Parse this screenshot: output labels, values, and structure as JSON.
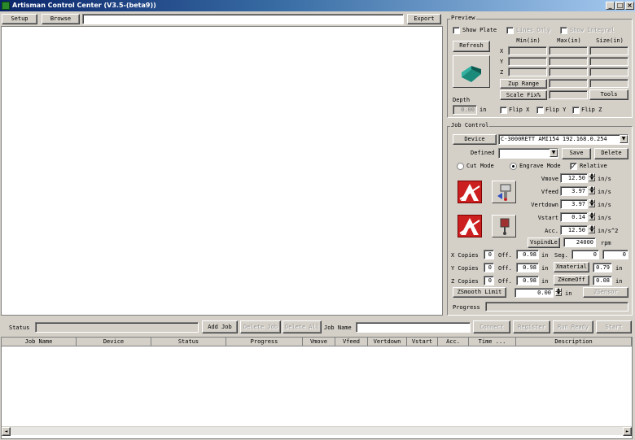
{
  "window": {
    "title": "Artisman Control Center (V3.5-(beta9))",
    "min_label": "_",
    "max_label": "□",
    "close_label": "×"
  },
  "toolbar": {
    "setup_label": "Setup",
    "browse_label": "Browse",
    "path_value": "",
    "export_label": "Export"
  },
  "preview": {
    "group_label": "Preview",
    "show_plate_label": "Show Plate",
    "lines_only_label": "Lines Only",
    "show_integral_label": "Show Integral",
    "refresh_label": "Refresh",
    "col_min": "Min(in)",
    "col_max": "Max(in)",
    "col_size": "Size(in)",
    "row_x": "X",
    "row_y": "Y",
    "row_z": "Z",
    "zup_range_label": "Zup Range",
    "scale_fixed_label": "Scale Fix%",
    "tools_label": "Tools",
    "depth_label": "Depth",
    "depth_value": "0.00",
    "depth_unit": "in",
    "flip_x_label": "Flip X",
    "flip_y_label": "Flip Y",
    "flip_z_label": "Flip Z"
  },
  "job_control": {
    "group_label": "Job Control",
    "device_label": "Device",
    "device_value": "C-3000RETT AMI154 192.168.0.254",
    "defined_label": "Defined",
    "defined_value": "",
    "save_label": "Save",
    "delete_label": "Delete",
    "cut_mode_label": "Cut Mode",
    "engrave_mode_label": "Engrave Mode",
    "relative_label": "Relative",
    "vmove_label": "Vmove",
    "vmove_value": "12.50",
    "vmove_unit": "in/s",
    "vfeed_label": "Vfeed",
    "vfeed_value": "3.97",
    "vfeed_unit": "in/s",
    "vertdown_label": "Vertdown",
    "vertdown_value": "3.97",
    "vertdown_unit": "in/s",
    "vstart_label": "Vstart",
    "vstart_value": "0.14",
    "vstart_unit": "in/s",
    "acc_label": "Acc.",
    "acc_value": "12.50",
    "acc_unit": "in/s^2",
    "vspindle_label": "VspindLe",
    "vspindle_value": "24000",
    "vspindle_unit": "rpm",
    "x_copies_label": "X Copies",
    "x_copies_value": "0",
    "x_off_label": "Off.",
    "x_off_value": "0.98",
    "x_off_unit": "in",
    "seg_label": "Seg.",
    "seg_value1": "0",
    "seg_value2": "0",
    "y_copies_label": "Y Copies",
    "y_copies_value": "0",
    "y_off_label": "Off.",
    "y_off_value": "0.98",
    "y_off_unit": "in",
    "xmaterial_label": "Xmaterial",
    "xmaterial_value": "0.79",
    "xmaterial_unit": "in",
    "z_copies_label": "Z Copies",
    "z_copies_value": "0",
    "z_off_label": "Off.",
    "z_off_value": "0.98",
    "z_off_unit": "in",
    "zhomeoff_label": "ZHomeOff",
    "zhomeoff_value": "0.08",
    "zhomeoff_unit": "in",
    "zsmooth_label": "ZSmooth Limit",
    "zsmooth_value": "0.00",
    "zsmooth_unit": "in",
    "zsensor_label": "ZSensor",
    "progress_label": "Progress",
    "progress_fraction": 0
  },
  "status_bar": {
    "status_label": "Status",
    "status_value": "",
    "add_job_label": "Add Job",
    "delete_job_label": "Delete Job",
    "delete_all_label": "Delete All",
    "job_name_label": "Job Name",
    "job_name_value": "",
    "connect_label": "Connect",
    "register_label": "Register",
    "run_ready_label": "Run Ready",
    "start_label": "Start"
  },
  "job_table": {
    "columns": [
      "Job Name",
      "Device",
      "Status",
      "Progress",
      "Vmove",
      "Vfeed",
      "Vertdown",
      "Vstart",
      "Acc.",
      "Time ...",
      "Description"
    ]
  },
  "scrollbar": {
    "left_arrow": "◄",
    "right_arrow": "►"
  }
}
